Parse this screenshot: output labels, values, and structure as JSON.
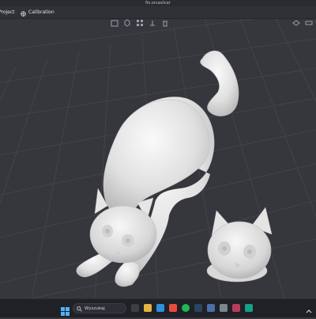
{
  "window": {
    "title": "fix.orcaslicer"
  },
  "menubar": {
    "project_label": "Project",
    "calibration_label": "Calibration"
  },
  "taskbar": {
    "search_label": "Wyszukaj"
  },
  "icons": {
    "start": "windows-start-icon",
    "search": "search-icon",
    "calibration": "calibration-icon",
    "tray": "chevron-up-icon"
  },
  "colors": {
    "background": "#35373c",
    "grid_line": "#44474d",
    "model_fill": "#e8e8e8",
    "taskbar": "#1f2126"
  }
}
